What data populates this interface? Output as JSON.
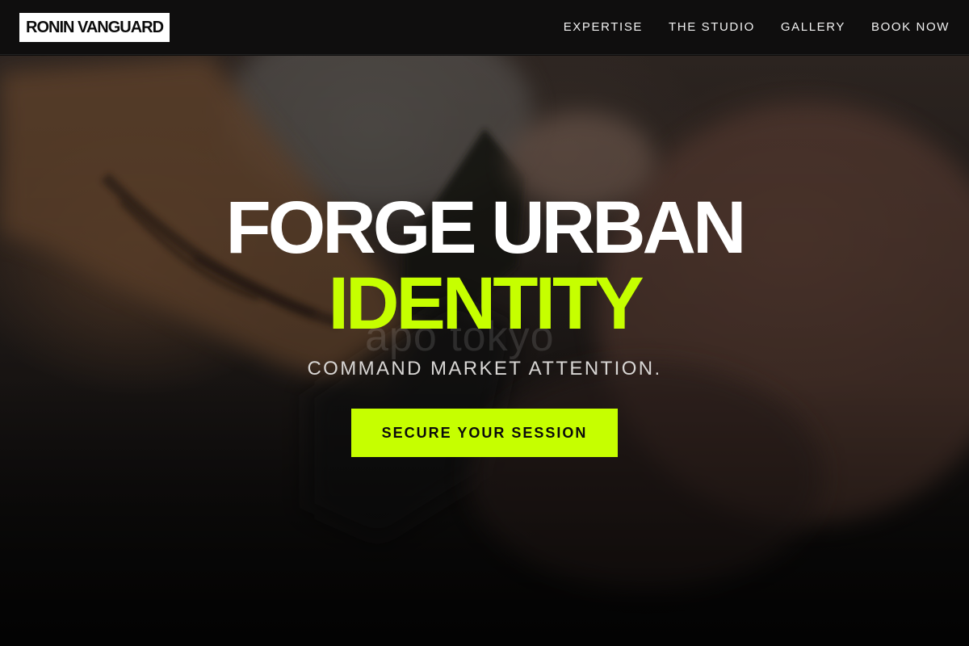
{
  "brand": {
    "name": "RONIN VANGUARD"
  },
  "nav": {
    "links": [
      {
        "label": "EXPERTISE"
      },
      {
        "label": "THE STUDIO"
      },
      {
        "label": "GALLERY"
      },
      {
        "label": "BOOK NOW"
      }
    ]
  },
  "hero": {
    "headline_line1": "FORGE URBAN",
    "headline_line2": "IDENTITY",
    "tagline": "COMMAND MARKET ATTENTION.",
    "cta_label": "SECURE YOUR SESSION",
    "image_watermark": "apo tokyo",
    "background_subject": "tattoo-session-photo"
  },
  "colors": {
    "accent": "#c6ff00",
    "nav_background": "#0f0e0e",
    "logo_background": "#ffffff",
    "text_primary": "#ffffff"
  }
}
